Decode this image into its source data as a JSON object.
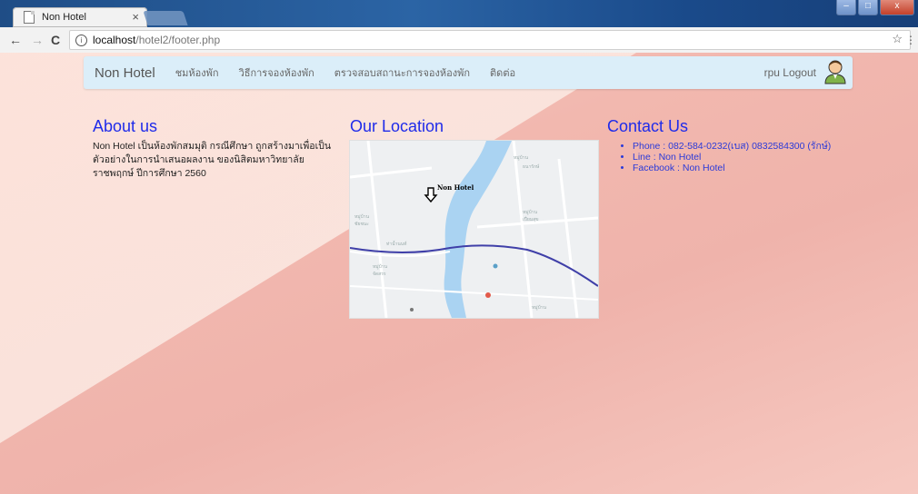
{
  "browser": {
    "tab_title": "Non Hotel",
    "tab_close": "×",
    "url_host": "localhost",
    "url_path": "/hotel2/footer.php",
    "back": "←",
    "forward": "→",
    "reload": "C",
    "info": "i",
    "star": "☆",
    "more": "⋮",
    "win_min": "–",
    "win_max": "□",
    "win_close": "x"
  },
  "navbar": {
    "brand": "Non Hotel",
    "links": [
      "ชมห้องพัก",
      "วิธีการจองห้องพัก",
      "ตรวจสอบสถานะการจองห้องพัก",
      "ติดต่อ"
    ],
    "logout": "rpu Logout"
  },
  "about": {
    "title": "About us",
    "text": "Non Hotel เป็นห้องพักสมมุติ กรณีศึกษา ถูกสร้างมาเพื่อเป็นตัวอย่างในการนำเสนอผลงาน ของนิสิตมหาวิทยาลัยราชพฤกษ์ ปีการศึกษา 2560"
  },
  "location": {
    "title": "Our Location",
    "marker_label": "Non Hotel"
  },
  "contact": {
    "title": "Contact Us",
    "items": [
      "Phone : 082-584-0232(เบส) 0832584300 (รักษ์)",
      "Line : Non Hotel",
      "Facebook : Non Hotel"
    ]
  },
  "colors": {
    "accent_title": "#1f2bea",
    "navbar_bg": "#dbeef9",
    "page_bg": "#f2b8af"
  }
}
